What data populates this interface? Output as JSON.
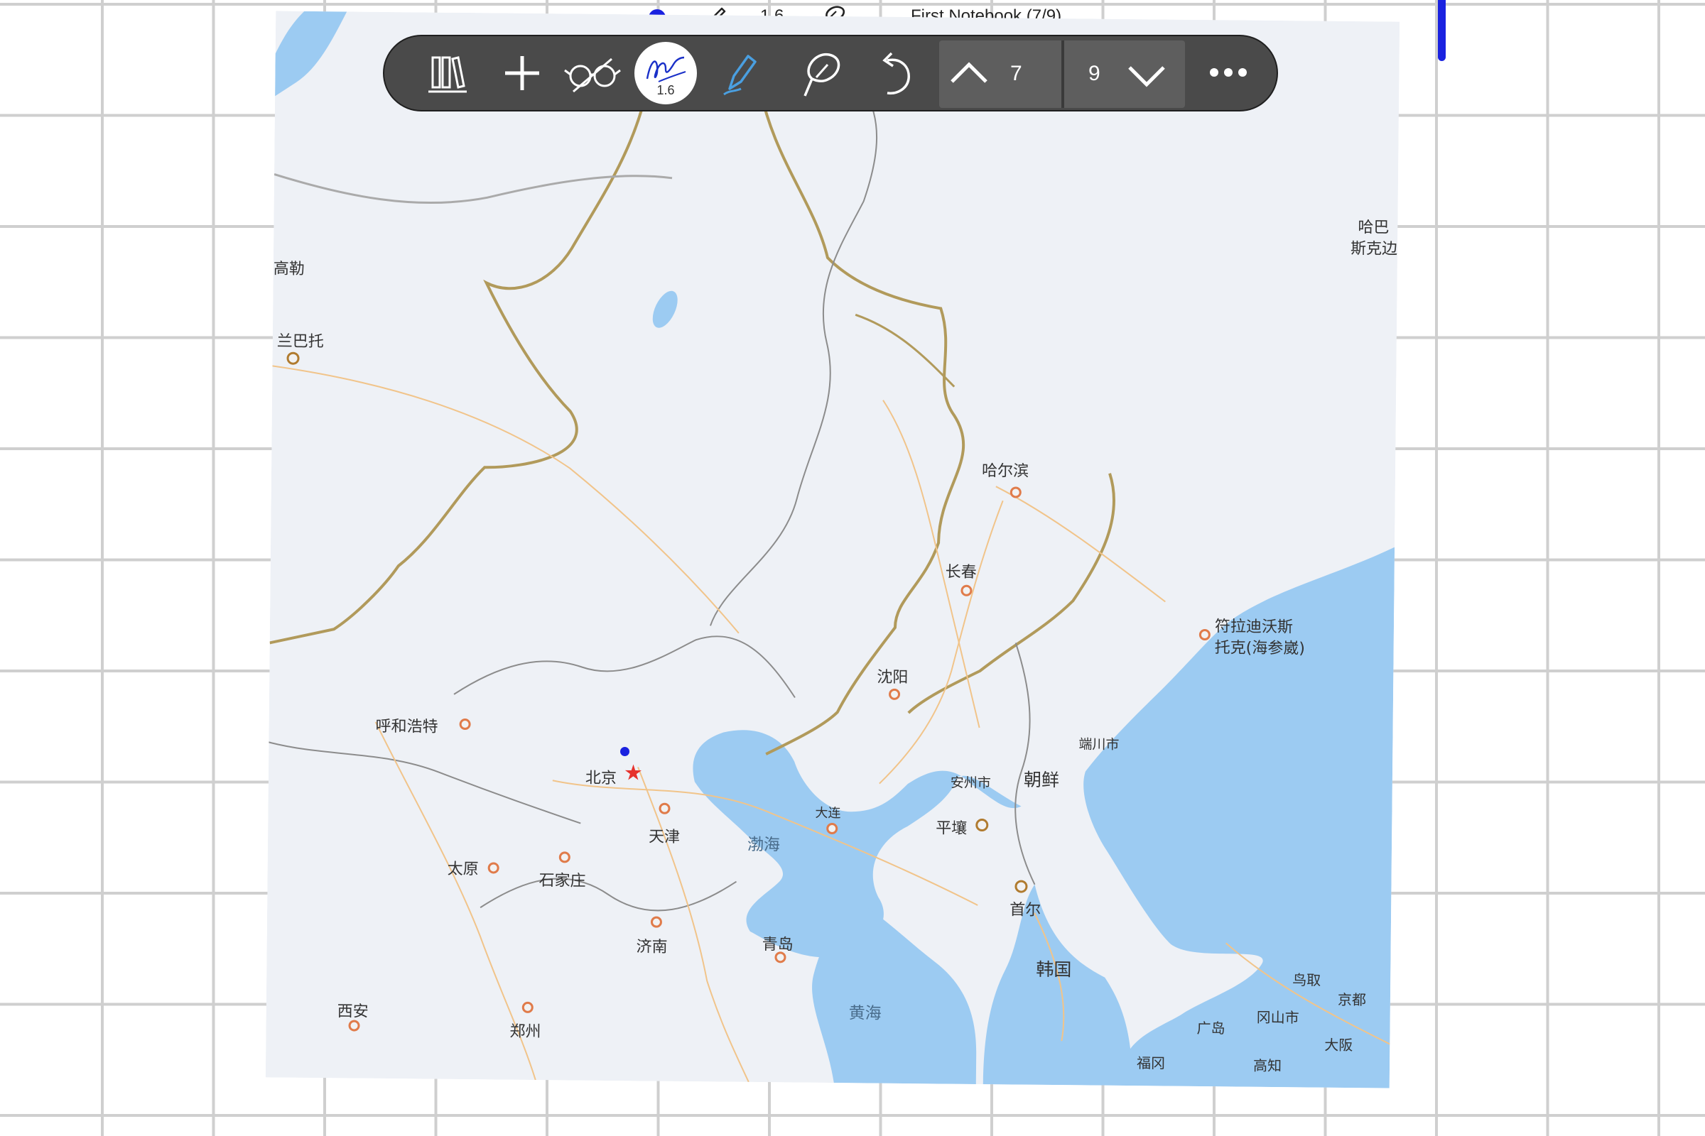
{
  "status_strip": {
    "pen_width": "1.6",
    "notebook_title": "First Notebook (7/9)",
    "accent_color": "#1a22e0"
  },
  "toolbar": {
    "library_icon": "library-icon",
    "add_icon": "plus-icon",
    "readonly_icon": "glasses-icon",
    "pen_width": "1.6",
    "highlighter_icon": "highlighter-icon",
    "lasso_icon": "lasso-icon",
    "undo_icon": "undo-icon",
    "current_page": "7",
    "total_pages": "9",
    "more_icon": "more-icon"
  },
  "map": {
    "labels": {
      "harbin": "哈尔滨",
      "changchun": "长春",
      "shenyang": "沈阳",
      "vladivostok_1": "符拉迪沃斯",
      "vladivostok_2": "托克(海参崴)",
      "khabarovsk_1": "哈巴",
      "khabarovsk_2": "斯克边",
      "ulaanbaatar": "兰巴托",
      "darkhan": "高勒",
      "hohhot": "呼和浩特",
      "beijing": "北京",
      "tianjin": "天津",
      "taiyuan": "太原",
      "shijiazhuang": "石家庄",
      "jinan": "济南",
      "qingdao": "青岛",
      "xian": "西安",
      "zhengzhou": "郑州",
      "dalian": "大连",
      "bohai": "渤海",
      "yellow_sea": "黄海",
      "north_korea": "朝鲜",
      "south_korea": "韩国",
      "pyongyang": "平壤",
      "anju": "安州市",
      "chongjin": "端川市",
      "seoul": "首尔",
      "tottori": "鸟取",
      "kyoto": "京都",
      "hiroshima": "广岛",
      "okayama": "冈山市",
      "osaka": "大阪",
      "fukuoka": "福冈",
      "kochi": "高知"
    }
  }
}
